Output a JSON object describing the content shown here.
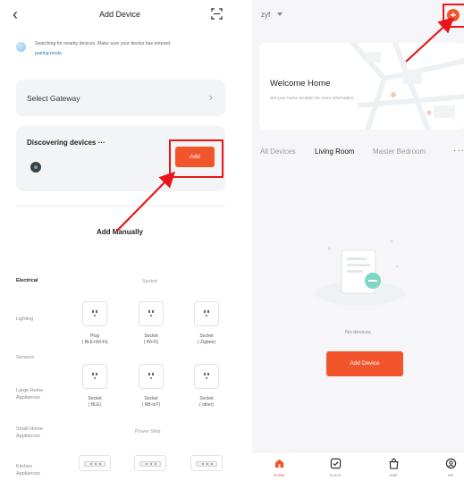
{
  "left": {
    "header": {
      "title": "Add Device",
      "back_icon": "chevron-left-icon",
      "scan_icon": "scan-icon"
    },
    "search": {
      "text": "Searching for nearby devices. Make sure your device has entered",
      "link": "pairing mode."
    },
    "gateway": {
      "label": "Select Gateway"
    },
    "discovering": {
      "label": "Discovering devices ···",
      "add_label": "Add"
    },
    "manual_title": "Add Manually",
    "categories": [
      "Electrical",
      "Lighting",
      "Sensors",
      "Large Home Appliances",
      "Small Home Appliances",
      "Kitchen Appliances"
    ],
    "sections": {
      "socket": "Socket",
      "power_strip": "Power Strip"
    },
    "sockets": [
      {
        "line1": "Plug",
        "line2": "( BLE+Wi-Fi)"
      },
      {
        "line1": "Socket",
        "line2": "( Wi-Fi)"
      },
      {
        "line1": "Socket",
        "line2": "( Zigbee)"
      },
      {
        "line1": "Socket",
        "line2": "( BLE)"
      },
      {
        "line1": "Socket",
        "line2": "( NB-IoT)"
      },
      {
        "line1": "Socket",
        "line2": "( other)"
      }
    ]
  },
  "right": {
    "user": "zyf",
    "welcome": {
      "title": "Welcome Home",
      "subtitle": "Set your home location for more information"
    },
    "tabs": [
      "All Devices",
      "Living Room",
      "Master Bedroom"
    ],
    "active_tab": "Living Room",
    "empty_text": "No devices",
    "add_device_label": "Add Device",
    "tabbar": [
      {
        "label": "Home",
        "icon": "home-icon",
        "active": true
      },
      {
        "label": "Scene",
        "icon": "scene-checkbox-icon",
        "active": false
      },
      {
        "label": "Mall",
        "icon": "shopping-bag-icon",
        "active": false
      },
      {
        "label": "Me",
        "icon": "profile-icon",
        "active": false
      }
    ]
  },
  "colors": {
    "accent": "#f2552c",
    "highlight": "#e8161b",
    "link": "#1a78c2"
  }
}
